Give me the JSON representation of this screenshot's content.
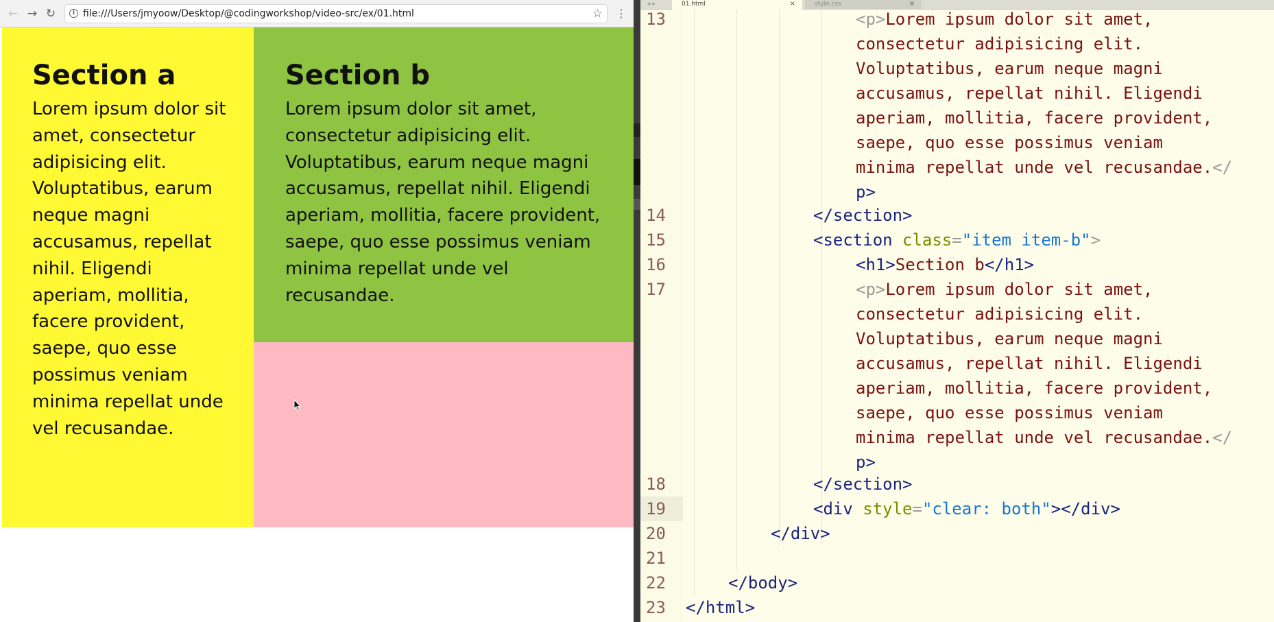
{
  "browser": {
    "url": "file:///Users/jmyoow/Desktop/@codingworkshop/video-src/ex/01.html",
    "icons": {
      "back": "←",
      "forward": "→",
      "reload": "↻",
      "info": "i",
      "star": "☆",
      "menu": "⋮"
    },
    "colors": {
      "section_a": "#fff934",
      "section_b": "#8fc442",
      "pink_block": "#ffb9c3"
    },
    "section_a": {
      "heading": "Section a",
      "paragraph": "Lorem ipsum dolor sit amet, consectetur adipisicing elit. Voluptatibus, earum neque magni accusamus, repellat nihil. Eligendi aperiam, mollitia, facere provident, saepe, quo esse possimus veniam minima repellat unde vel recusandae."
    },
    "section_b": {
      "heading": "Section b",
      "paragraph": "Lorem ipsum dolor sit amet, consectetur adipisicing elit. Voluptatibus, earum neque magni accusamus, repellat nihil. Eligendi aperiam, mollitia, facere provident, saepe, quo esse possimus veniam minima repellat unde vel recusandae."
    }
  },
  "editor": {
    "tabs": [
      {
        "label": "01.html",
        "close": "×",
        "active": true
      },
      {
        "label": "style.css",
        "close": "×",
        "active": false
      }
    ],
    "tab_arrows": "◂ ▸",
    "line_numbers": [
      "13",
      "14",
      "15",
      "16",
      "17",
      "18",
      "19",
      "20",
      "21",
      "22",
      "23"
    ],
    "code": {
      "l13a_tag": "<p>",
      "l13a_text": "Lorem ipsum dolor sit amet,",
      "l13b": "consectetur adipisicing elit.",
      "l13c": "Voluptatibus, earum neque magni",
      "l13d": "accusamus, repellat nihil. Eligendi",
      "l13e": "aperiam, mollitia, facere provident,",
      "l13f": "saepe, quo esse possimus veniam",
      "l13g_text": "minima repellat unde vel recusandae.",
      "l13g_tag": "</",
      "l13h_tag": "p>",
      "l14": "</section>",
      "l15_open": "<section",
      "l15_attr": "class",
      "l15_eq": "=",
      "l15_val": "\"item item-b\"",
      "l15_close": ">",
      "l16_open": "<h1>",
      "l16_text": "Section b",
      "l16_close": "</h1>",
      "l17a_tag": "<p>",
      "l17a_text": "Lorem ipsum dolor sit amet,",
      "l17b": "consectetur adipisicing elit.",
      "l17c": "Voluptatibus, earum neque magni",
      "l17d": "accusamus, repellat nihil. Eligendi",
      "l17e": "aperiam, mollitia, facere provident,",
      "l17f": "saepe, quo esse possimus veniam",
      "l17g_text": "minima repellat unde vel recusandae.",
      "l17g_tag": "</",
      "l17h_tag": "p>",
      "l18": "</section>",
      "l19_open": "<div",
      "l19_attr": "style",
      "l19_eq": "=",
      "l19_val": "\"clear: both\"",
      "l19_close": "></div>",
      "l20": "</div>",
      "l22": "</body>",
      "l23": "</html>"
    }
  }
}
